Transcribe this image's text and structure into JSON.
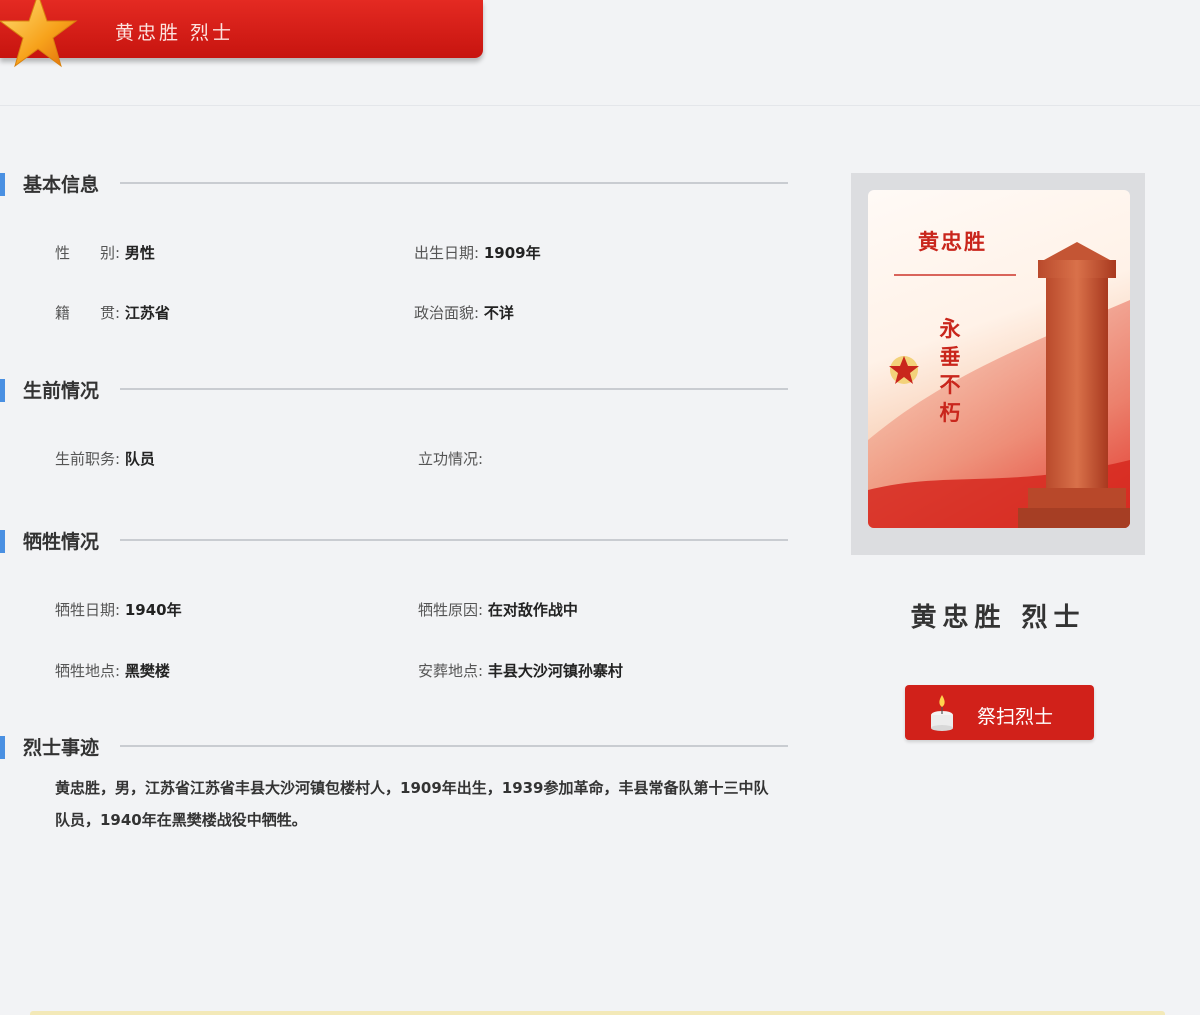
{
  "header": {
    "title": "黄忠胜 烈士"
  },
  "sections": {
    "basic": {
      "title": "基本信息",
      "gender": {
        "label": "性　　别",
        "value": "男性"
      },
      "birth_date": {
        "label": "出生日期",
        "value": "1909年"
      },
      "native_place": {
        "label": "籍　　贯",
        "value": "江苏省"
      },
      "political_status": {
        "label": "政治面貌",
        "value": "不详"
      }
    },
    "life": {
      "title": "生前情况",
      "position": {
        "label": "生前职务",
        "value": "队员"
      },
      "merit": {
        "label": "立功情况",
        "value": ""
      }
    },
    "sacrifice": {
      "title": "牺牲情况",
      "date": {
        "label": "牺牲日期",
        "value": "1940年"
      },
      "reason": {
        "label": "牺牲原因",
        "value": "在对敌作战中"
      },
      "place": {
        "label": "牺牲地点",
        "value": "黑樊楼"
      },
      "burial": {
        "label": "安葬地点",
        "value": "丰县大沙河镇孙寨村"
      }
    },
    "deeds": {
      "title": "烈士事迹",
      "text": "黄忠胜，男，江苏省江苏省丰县大沙河镇包楼村人，1909年出生，1939参加革命，丰县常备队第十三中队队员，1940年在黑樊楼战役中牺牲。"
    }
  },
  "portrait": {
    "name": "黄忠胜",
    "slogan": "永垂不朽"
  },
  "sidebar": {
    "name": "黄忠胜 烈士",
    "tribute_button": "祭扫烈士"
  },
  "colors": {
    "banner_red": "#d41d17",
    "accent_blue": "#4a90e2",
    "button_red": "#d1211a"
  }
}
